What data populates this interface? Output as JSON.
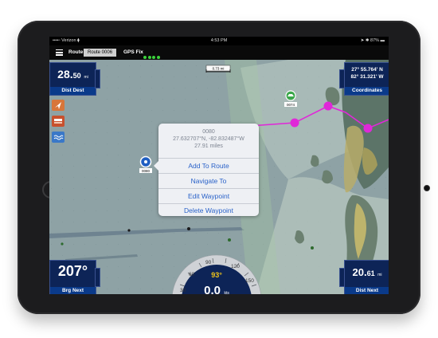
{
  "status_bar": {
    "carrier": "••••◦ Verizon ⧫",
    "time": "4:53 PM",
    "battery": "➤ ✱ 87% ▬"
  },
  "toolbar": {
    "route_label": "Route:",
    "route_value": "Route 0006",
    "gps_label": "GPS Fix"
  },
  "scale_bar": {
    "label": "0.73 mi"
  },
  "dist_dest": {
    "value": "28.",
    "decimal": "50",
    "unit": "mi",
    "label": "Dist Dest"
  },
  "coordinates": {
    "lat": "27° 55.764' N",
    "lon": "82° 31.321' W",
    "label": "Coordinates"
  },
  "brg_next": {
    "value": "207°",
    "label": "Brg Next"
  },
  "dist_next": {
    "value": "20.",
    "decimal": "61",
    "unit": "mi",
    "label": "Dist Next"
  },
  "gauge": {
    "heading": "93°",
    "speed": "0.",
    "speed_decimal": "0",
    "speed_unit": "kts",
    "ticks": [
      "30",
      "60",
      "90",
      "120",
      "150"
    ]
  },
  "waypoints": {
    "selected": "0080",
    "route_wp": "0074"
  },
  "popup": {
    "id": "0080",
    "coords": "27.632707°N, -82.832487°W",
    "distance": "27.91 miles",
    "items": [
      "Add To Route",
      "Navigate To",
      "Edit Waypoint",
      "Delete Waypoint"
    ]
  },
  "colors": {
    "route": "#e028d8",
    "panel": "#0d2457",
    "water": "#8fa3a6",
    "land": "#5c7468"
  }
}
